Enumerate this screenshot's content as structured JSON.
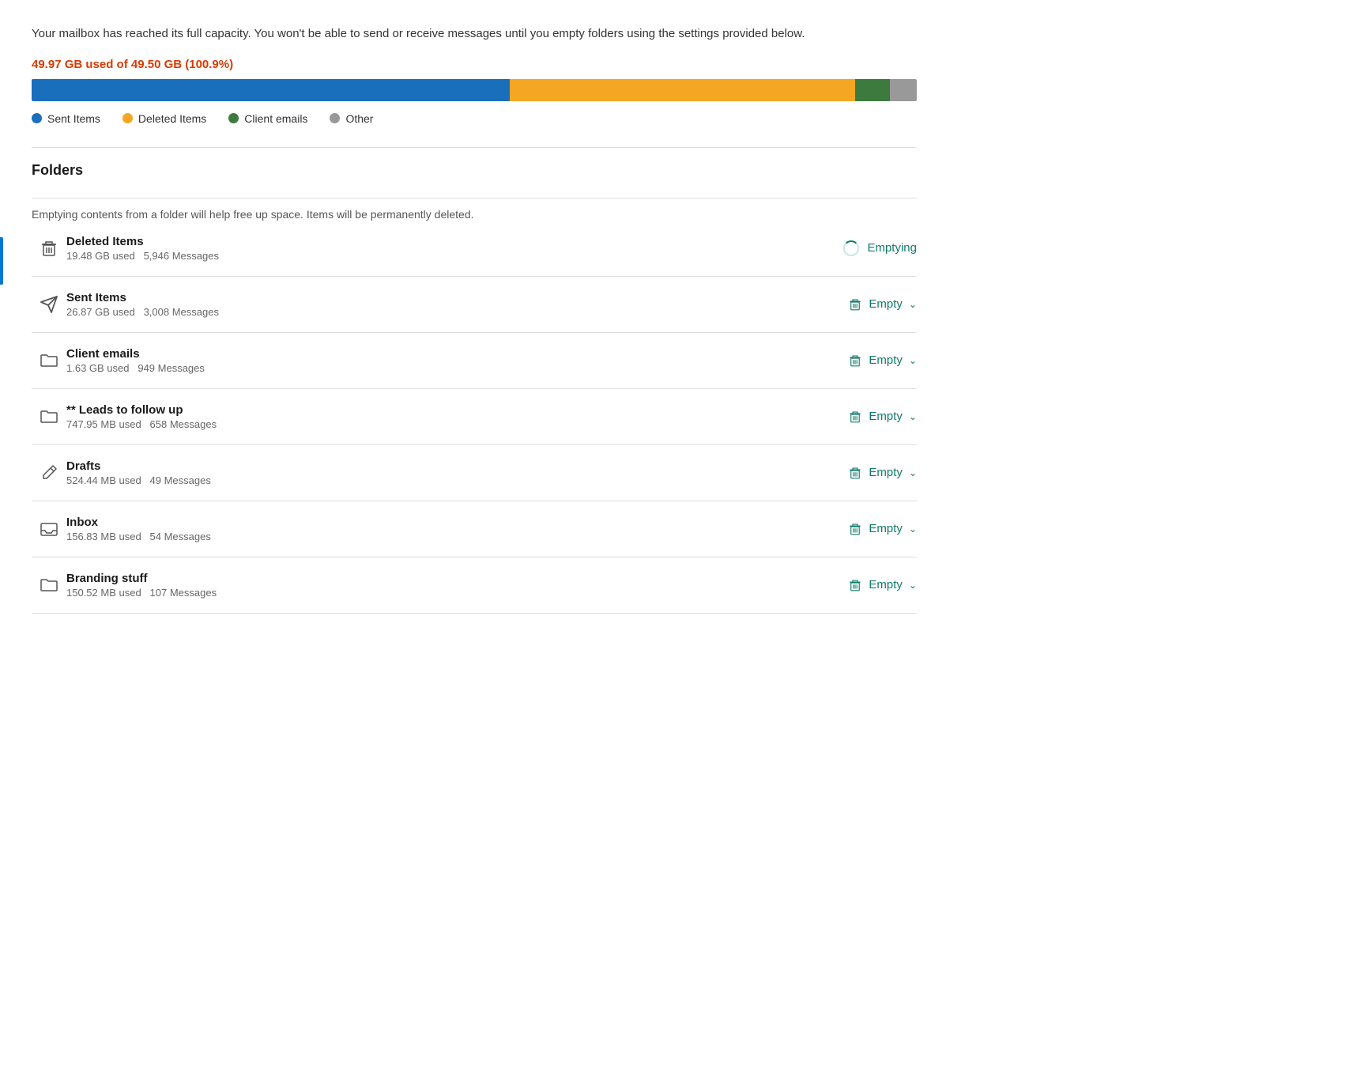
{
  "alert": {
    "text": "Your mailbox has reached its full capacity. You won't be able to send or receive messages until you empty folders using the settings provided below."
  },
  "usage": {
    "label": "49.97 GB used of 49.50 GB (100.9%)",
    "segments": [
      {
        "name": "sent_items",
        "color": "#1a6fbd",
        "percent": 54
      },
      {
        "name": "deleted_items",
        "color": "#f5a623",
        "percent": 39
      },
      {
        "name": "client_emails",
        "color": "#3d7a3d",
        "percent": 4
      },
      {
        "name": "other",
        "color": "#999999",
        "percent": 3
      }
    ],
    "legend": [
      {
        "label": "Sent Items",
        "color": "#1a6fbd"
      },
      {
        "label": "Deleted Items",
        "color": "#f5a623"
      },
      {
        "label": "Client emails",
        "color": "#3d7a3d"
      },
      {
        "label": "Other",
        "color": "#999999"
      }
    ]
  },
  "folders": {
    "title": "Folders",
    "description": "Emptying contents from a folder will help free up space. Items will be permanently deleted.",
    "items": [
      {
        "name": "Deleted Items",
        "icon": "trash",
        "size": "19.48 GB used",
        "messages": "5,946 Messages",
        "action": "Emptying",
        "action_type": "emptying"
      },
      {
        "name": "Sent Items",
        "icon": "sent",
        "size": "26.87 GB used",
        "messages": "3,008 Messages",
        "action": "Empty",
        "action_type": "empty"
      },
      {
        "name": "Client emails",
        "icon": "folder",
        "size": "1.63 GB used",
        "messages": "949 Messages",
        "action": "Empty",
        "action_type": "empty"
      },
      {
        "name": "** Leads to follow up",
        "icon": "folder",
        "size": "747.95 MB used",
        "messages": "658 Messages",
        "action": "Empty",
        "action_type": "empty"
      },
      {
        "name": "Drafts",
        "icon": "drafts",
        "size": "524.44 MB used",
        "messages": "49 Messages",
        "action": "Empty",
        "action_type": "empty"
      },
      {
        "name": "Inbox",
        "icon": "inbox",
        "size": "156.83 MB used",
        "messages": "54 Messages",
        "action": "Empty",
        "action_type": "empty"
      },
      {
        "name": "Branding stuff",
        "icon": "folder",
        "size": "150.52 MB used",
        "messages": "107 Messages",
        "action": "Empty",
        "action_type": "empty"
      }
    ],
    "empty_label": "Empty",
    "emptying_label": "Emptying"
  }
}
